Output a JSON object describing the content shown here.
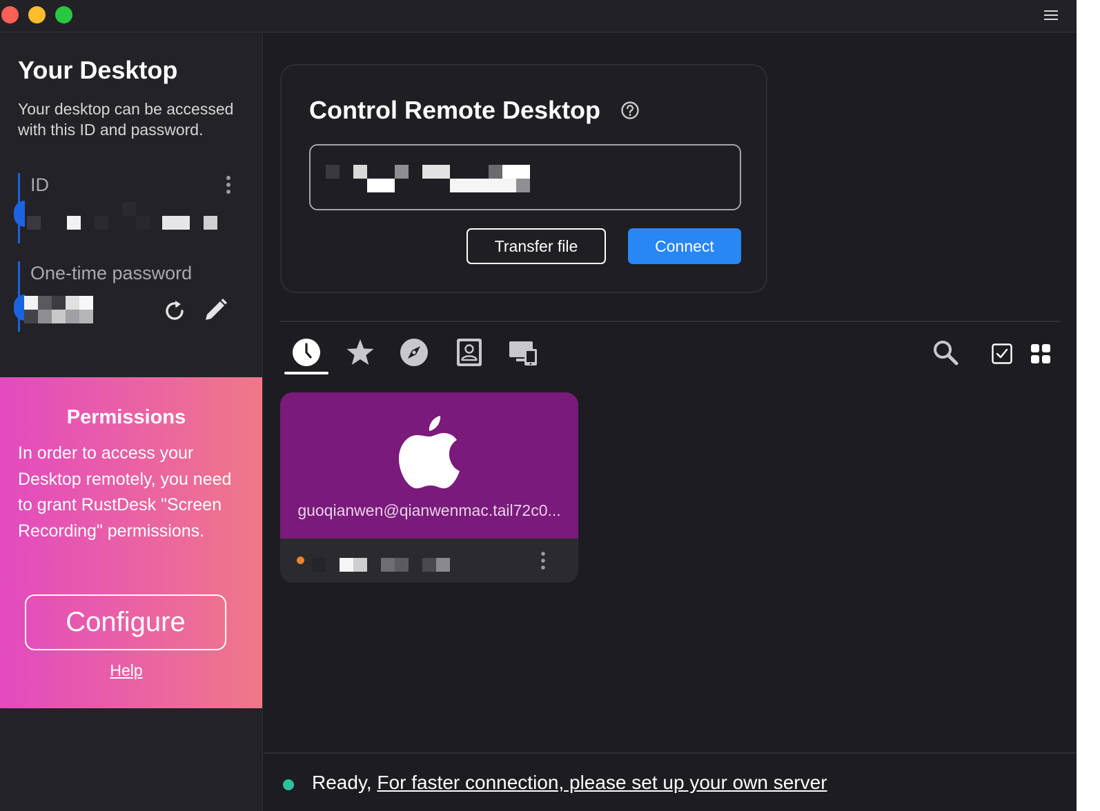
{
  "sidebar": {
    "title": "Your Desktop",
    "description": "Your desktop can be accessed with this ID and password.",
    "id_label": "ID",
    "otp_label": "One-time password"
  },
  "permissions": {
    "title": "Permissions",
    "text": "In order to access your Desktop remotely, you need to grant RustDesk \"Screen Recording\" permissions.",
    "configure_label": "Configure",
    "help_label": "Help",
    "gradient_start": "#e34ac0",
    "gradient_end": "#f07889"
  },
  "connect": {
    "title": "Control Remote Desktop",
    "transfer_label": "Transfer file",
    "connect_label": "Connect",
    "accent": "#2886f5"
  },
  "tabs": [
    {
      "name": "recent",
      "icon": "clock-icon",
      "selected": true
    },
    {
      "name": "favorites",
      "icon": "star-icon",
      "selected": false
    },
    {
      "name": "discovered",
      "icon": "compass-icon",
      "selected": false
    },
    {
      "name": "address-book",
      "icon": "contact-icon",
      "selected": false
    },
    {
      "name": "group",
      "icon": "devices-icon",
      "selected": false
    }
  ],
  "peers": [
    {
      "name": "guoqianwen@qianwenmac.tail72c0...",
      "os_icon": "apple-icon",
      "card_color": "#7a1a7a",
      "status_color": "#f0822d"
    }
  ],
  "status": {
    "ready": "Ready,",
    "link": "For faster connection, please set up your own server",
    "dot_color": "#2dc19c"
  }
}
